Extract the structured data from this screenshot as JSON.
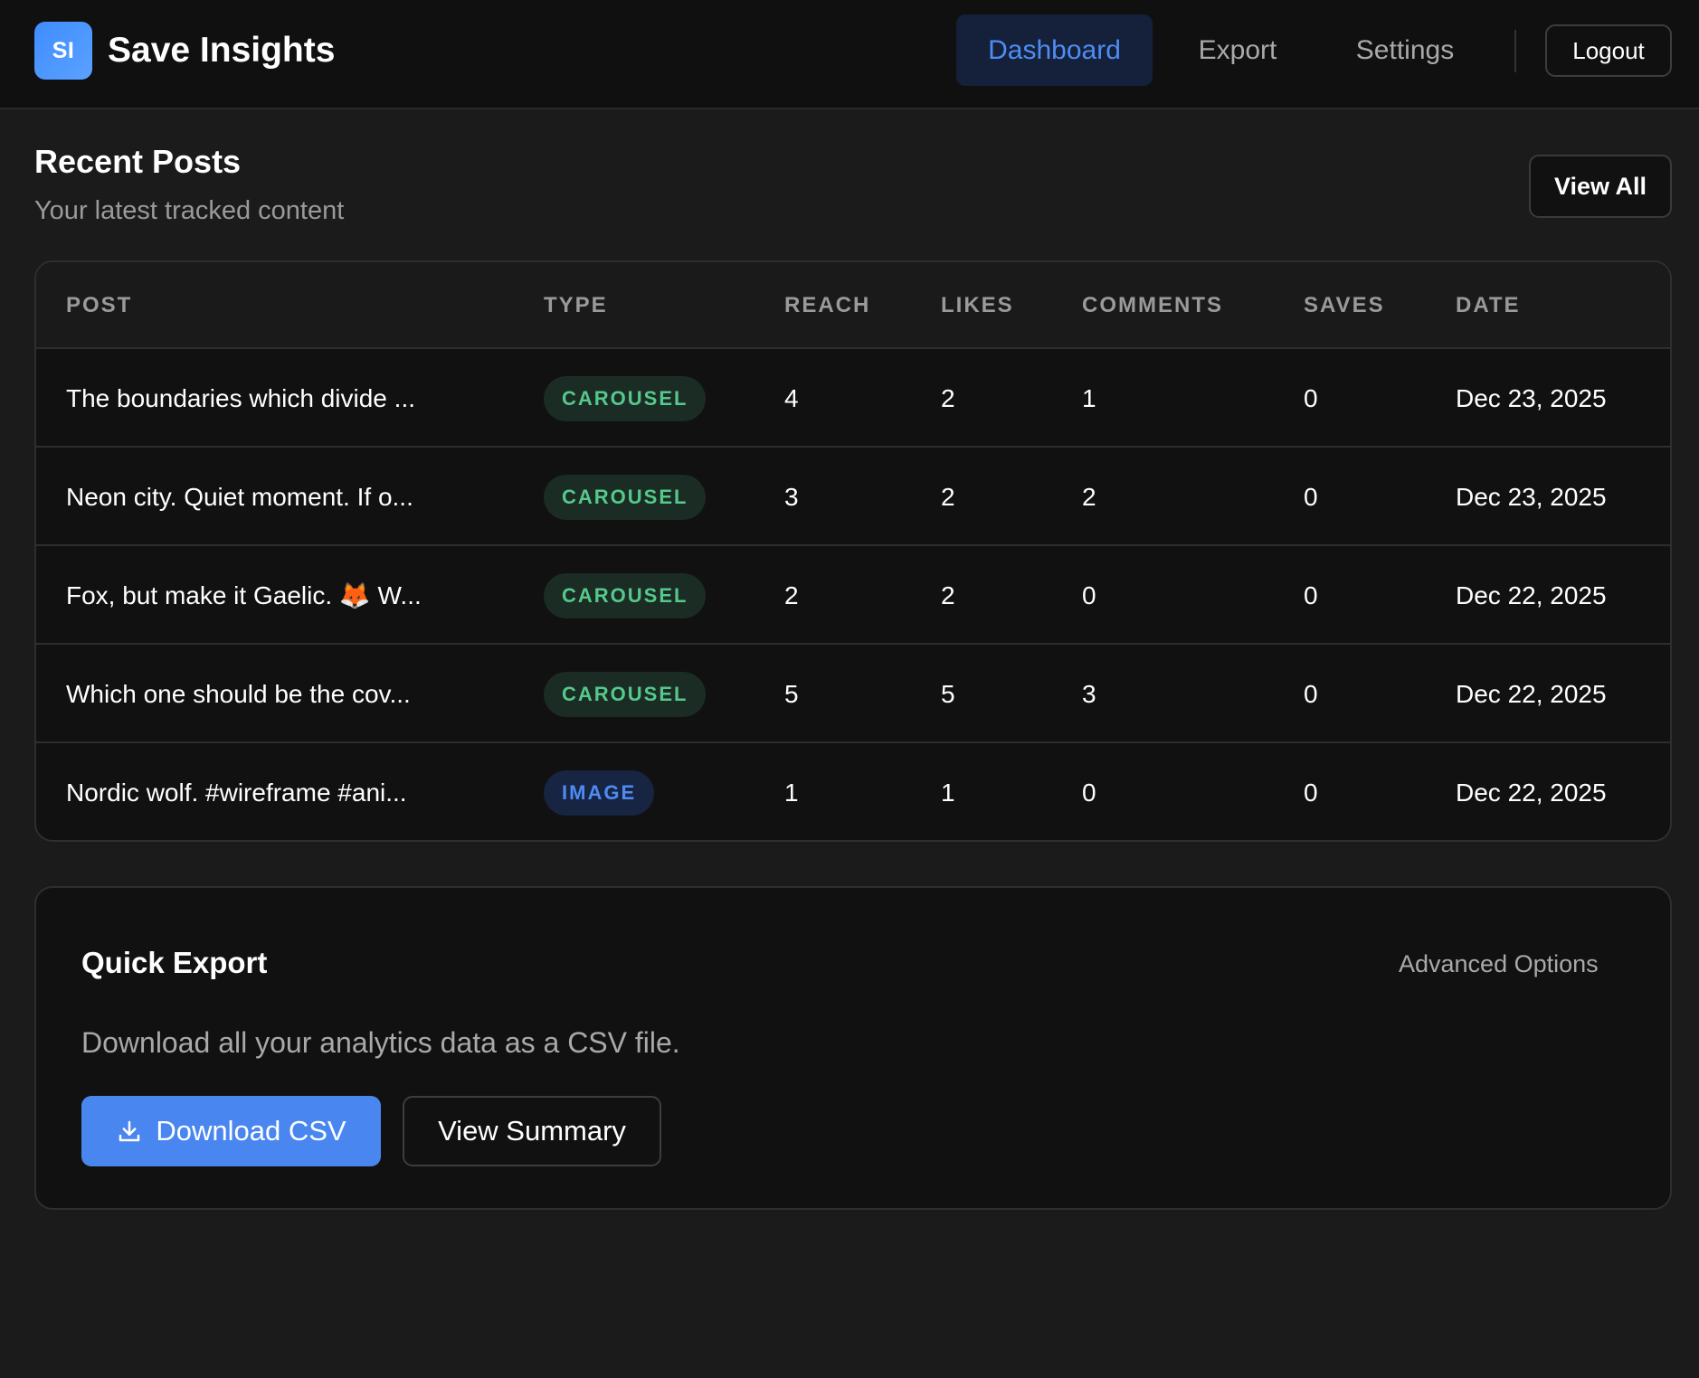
{
  "app": {
    "logo_text": "SI",
    "title": "Save Insights"
  },
  "nav": {
    "items": [
      {
        "label": "Dashboard",
        "active": true
      },
      {
        "label": "Export",
        "active": false
      },
      {
        "label": "Settings",
        "active": false
      }
    ],
    "logout_label": "Logout"
  },
  "recent_posts": {
    "title": "Recent Posts",
    "subtitle": "Your latest tracked content",
    "view_all_label": "View All",
    "columns": [
      "POST",
      "TYPE",
      "REACH",
      "LIKES",
      "COMMENTS",
      "SAVES",
      "DATE"
    ],
    "rows": [
      {
        "post": "The boundaries which divide ...",
        "type": "CAROUSEL",
        "reach": "4",
        "likes": "2",
        "comments": "1",
        "saves": "0",
        "date": "Dec 23, 2025"
      },
      {
        "post": "Neon city. Quiet moment. If o...",
        "type": "CAROUSEL",
        "reach": "3",
        "likes": "2",
        "comments": "2",
        "saves": "0",
        "date": "Dec 23, 2025"
      },
      {
        "post": "Fox, but make it Gaelic. 🦊 W...",
        "type": "CAROUSEL",
        "reach": "2",
        "likes": "2",
        "comments": "0",
        "saves": "0",
        "date": "Dec 22, 2025"
      },
      {
        "post": "Which one should be the cov...",
        "type": "CAROUSEL",
        "reach": "5",
        "likes": "5",
        "comments": "3",
        "saves": "0",
        "date": "Dec 22, 2025"
      },
      {
        "post": "Nordic wolf. #wireframe #ani...",
        "type": "IMAGE",
        "reach": "1",
        "likes": "1",
        "comments": "0",
        "saves": "0",
        "date": "Dec 22, 2025"
      }
    ]
  },
  "quick_export": {
    "title": "Quick Export",
    "advanced_label": "Advanced Options",
    "description": "Download all your analytics data as a CSV file.",
    "download_label": "Download CSV",
    "download_icon": "download-icon",
    "summary_label": "View Summary"
  },
  "colors": {
    "accent": "#4a86f0",
    "carousel_badge_text": "#55c98c",
    "image_badge_text": "#4e8cf4",
    "background": "#1b1b1b",
    "card": "#111111"
  }
}
